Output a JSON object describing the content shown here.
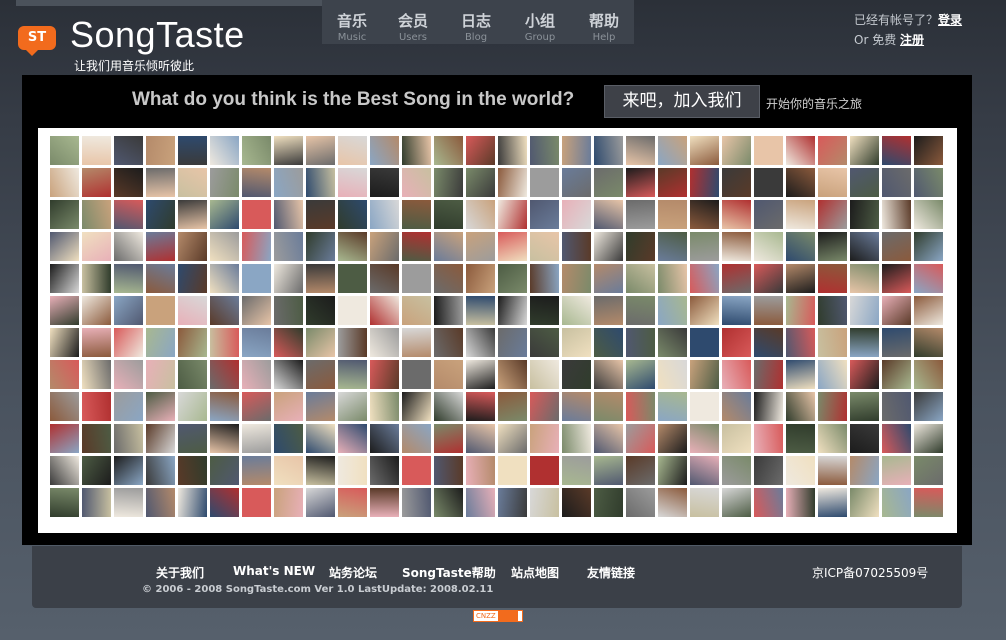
{
  "header": {
    "logo_text": "ST",
    "site_title": "SongTaste",
    "slogan": "让我们用音乐倾听彼此"
  },
  "nav": [
    {
      "zh": "音乐",
      "en": "Music"
    },
    {
      "zh": "会员",
      "en": "Users"
    },
    {
      "zh": "日志",
      "en": "Blog"
    },
    {
      "zh": "小组",
      "en": "Group"
    },
    {
      "zh": "帮助",
      "en": "Help"
    }
  ],
  "account": {
    "have_account": "已经有帐号了？",
    "login": "登录",
    "or_free": "Or 免费",
    "register": "注册"
  },
  "hero": {
    "question": "What do you think is the Best Song in the world?",
    "join_label": "来吧，加入我们",
    "join_sub": "开始你的音乐之旅"
  },
  "avatars": {
    "rows": 12,
    "cols": 28,
    "colors": [
      "#1c1c1c",
      "#3a3a3a",
      "#6b6b6b",
      "#9c9c9c",
      "#d8d8d8",
      "#efe9df",
      "#b48a6a",
      "#8b5a3c",
      "#5a3a28",
      "#c9a27c",
      "#e8c5a8",
      "#7a8a6a",
      "#4d5c44",
      "#a8b890",
      "#6a7c9a",
      "#2e4a6e",
      "#8aa6c4",
      "#b03030",
      "#d85a5a",
      "#e8b0b8",
      "#c8c0a0",
      "#505870",
      "#f0e0c0",
      "#303c2c"
    ]
  },
  "footer": {
    "links": [
      "关于我们",
      "What's NEW",
      "站务论坛",
      "SongTaste帮助",
      "站点地图",
      "友情链接"
    ],
    "copyright": "© 2006 - 2008 SongTaste.com   Ver 1.0   LastUpdate: 2008.02.11",
    "icp": "京ICP备07025509号"
  },
  "badge": "CNZZ"
}
